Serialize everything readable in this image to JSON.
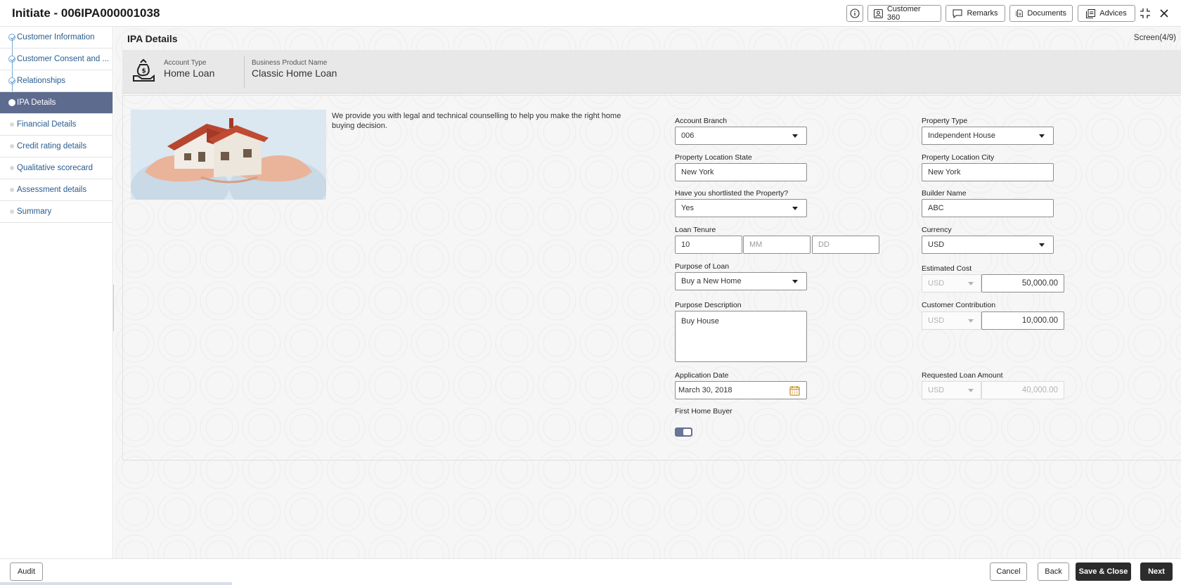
{
  "header": {
    "title": "Initiate - 006IPA000001038",
    "buttons": {
      "customer360": "Customer 360",
      "remarks": "Remarks",
      "documents": "Documents",
      "advices": "Advices"
    }
  },
  "sidebar": {
    "items": [
      {
        "label": "Customer Information",
        "state": "done"
      },
      {
        "label": "Customer Consent and ...",
        "state": "done"
      },
      {
        "label": "Relationships",
        "state": "done"
      },
      {
        "label": "IPA Details",
        "state": "current"
      },
      {
        "label": "Financial Details",
        "state": "pending"
      },
      {
        "label": "Credit rating details",
        "state": "pending"
      },
      {
        "label": "Qualitative scorecard",
        "state": "pending"
      },
      {
        "label": "Assessment details",
        "state": "pending"
      },
      {
        "label": "Summary",
        "state": "pending"
      }
    ]
  },
  "main": {
    "section_title": "IPA Details",
    "screen_counter": "Screen(4/9)",
    "product": {
      "account_type_label": "Account Type",
      "account_type": "Home Loan",
      "business_product_label": "Business Product Name",
      "business_product": "Classic Home Loan"
    },
    "intro_text": "We provide you with legal and technical counselling to help you make the right home buying decision.",
    "form": {
      "account_branch": {
        "label": "Account Branch",
        "value": "006"
      },
      "property_type": {
        "label": "Property Type",
        "value": "Independent House"
      },
      "property_location_state": {
        "label": "Property Location State",
        "value": "New York"
      },
      "property_location_city": {
        "label": "Property Location City",
        "value": "New York"
      },
      "shortlisted": {
        "label": "Have you shortlisted the Property?",
        "value": "Yes"
      },
      "builder_name": {
        "label": "Builder Name",
        "value": "ABC"
      },
      "loan_tenure": {
        "label": "Loan Tenure",
        "years": "10",
        "mm_placeholder": "MM",
        "dd_placeholder": "DD"
      },
      "currency": {
        "label": "Currency",
        "value": "USD"
      },
      "purpose_of_loan": {
        "label": "Purpose of Loan",
        "value": "Buy a New Home"
      },
      "estimated_cost": {
        "label": "Estimated Cost",
        "currency": "USD",
        "amount": "50,000.00"
      },
      "purpose_description": {
        "label": "Purpose Description",
        "value": "Buy House"
      },
      "customer_contribution": {
        "label": "Customer Contribution",
        "currency": "USD",
        "amount": "10,000.00"
      },
      "application_date": {
        "label": "Application Date",
        "value": "March 30, 2018"
      },
      "requested_loan_amount": {
        "label": "Requested Loan Amount",
        "currency": "USD",
        "amount": "40,000.00"
      },
      "first_home_buyer": {
        "label": "First Home Buyer",
        "enabled": true
      }
    }
  },
  "footer": {
    "audit": "Audit",
    "cancel": "Cancel",
    "back": "Back",
    "save_close": "Save & Close",
    "next": "Next"
  },
  "colors": {
    "active_step": "#5d6b8f",
    "link": "#2a5d8f",
    "dark_button": "#2c2c2c",
    "calendar_icon": "#c98a1e"
  }
}
